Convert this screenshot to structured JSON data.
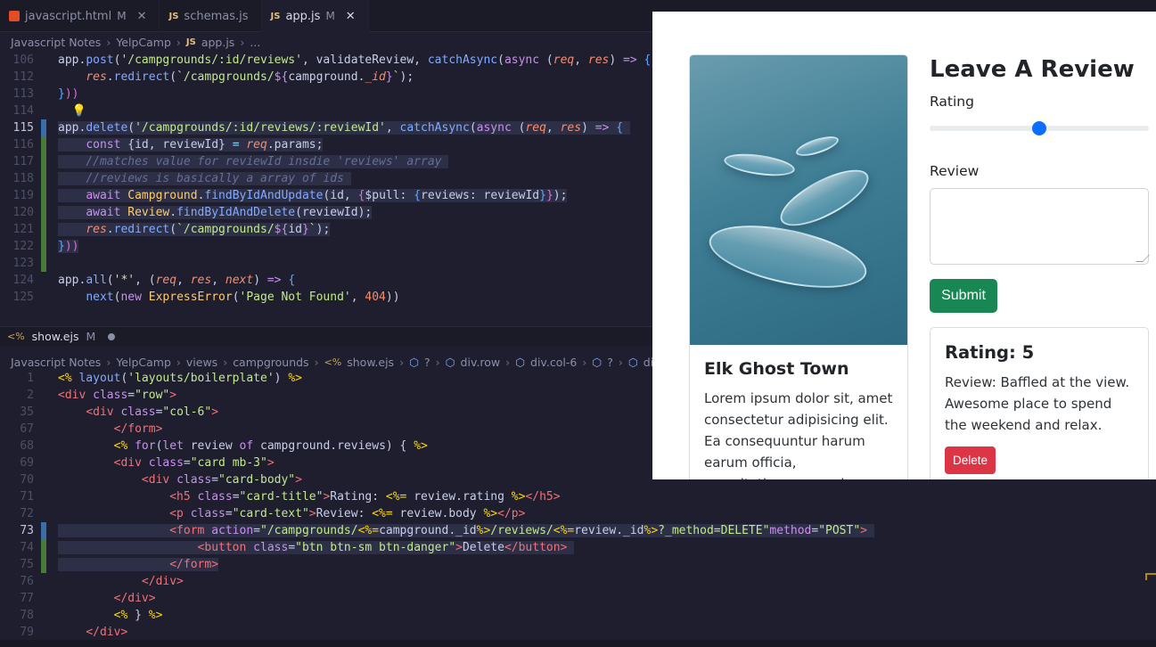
{
  "tabs": [
    {
      "name": "javascript.html",
      "badge": "M",
      "icon": "html-icon"
    },
    {
      "name": "schemas.js",
      "badge": "",
      "icon": "js-icon"
    },
    {
      "name": "app.js",
      "badge": "M",
      "icon": "js-icon"
    }
  ],
  "top_breadcrumb": [
    "Javascript Notes",
    "YelpCamp",
    "app.js",
    "..."
  ],
  "top_code": [
    {
      "n": "106",
      "html": "<span class='txt'>app.<span class='t-fn'>post</span>(<span class='t-str'>'/campgrounds/:id/reviews'</span>, validateReview, <span class='t-fn'>catchAsync</span>(<span class='t-kw'>async</span> (<span class='t-par'>req</span>, <span class='t-par'>res</span>) <span class='t-kw'>=&gt;</span> <span class='t-br3'>{</span></span>"
    },
    {
      "n": "112",
      "html": "<span class='txt'>    <span class='t-par'>res</span>.<span class='t-fn'>redirect</span>(<span class='t-str'>`/campgrounds/</span><span class='t-kw'>${</span>campground.<span class='t-par'>_id</span><span class='t-kw'>}</span><span class='t-str'>`</span>);</span>"
    },
    {
      "n": "113",
      "html": "<span class='txt'><span class='t-br3'>}</span><span class='t-br2'>))</span></span>"
    },
    {
      "n": "114",
      "html": "<span class='txt'>  <span class='t-br'>💡</span></span>"
    },
    {
      "n": "115",
      "cur": true,
      "gut": "mod",
      "hl": true,
      "html": "<span class='txt'>app.<span class='t-fn'>delete</span>(<span class='t-str'>'/campgrounds/:id/reviews/:reviewId'</span>, <span class='t-fn'>catchAsync</span>(<span class='t-kw'>async</span> (<span class='t-par'>req</span>, <span class='t-par'>res</span>) <span class='t-kw'>=&gt;</span> <span class='t-br3'>{</span> </span>"
    },
    {
      "n": "116",
      "gut": "add",
      "hl": true,
      "html": "<span class='txt'>    <span class='t-kw'>const</span> {id, reviewId} <span class='t-op'>=</span> <span class='t-par'>req</span>.params;</span>"
    },
    {
      "n": "117",
      "gut": "add",
      "hl": true,
      "html": "<span class='txt'>    <span class='t-com'>//matches value for reviewId insdie 'reviews' array </span></span>"
    },
    {
      "n": "118",
      "gut": "add",
      "hl": true,
      "html": "<span class='txt'>    <span class='t-com'>//reviews is basically a array of ids </span></span>"
    },
    {
      "n": "119",
      "gut": "add",
      "hl": true,
      "html": "<span class='txt'>    <span class='t-kw'>await</span> <span class='t-cls'>Campground</span>.<span class='t-fn'>findByIdAndUpdate</span>(id, <span class='t-br2'>{</span>$pull: <span class='t-br3'>{</span>reviews: reviewId<span class='t-br3'>}</span><span class='t-br2'>}</span>);</span>"
    },
    {
      "n": "120",
      "gut": "add",
      "hl": true,
      "html": "<span class='txt'>    <span class='t-kw'>await</span> <span class='t-cls'>Review</span>.<span class='t-fn'>findByIdAndDelete</span>(reviewId);</span>"
    },
    {
      "n": "121",
      "gut": "add",
      "hl": true,
      "html": "<span class='txt'>    <span class='t-par'>res</span>.<span class='t-fn'>redirect</span>(<span class='t-str'>`/campgrounds/</span><span class='t-kw'>${</span>id<span class='t-kw'>}</span><span class='t-str'>`</span>);</span>"
    },
    {
      "n": "122",
      "gut": "add",
      "hl": true,
      "html": "<span class='txt'><span class='t-br3'>}</span><span class='t-br2'>))</span></span>"
    },
    {
      "n": "123",
      "gut": "add",
      "html": "<span class='txt'></span>"
    },
    {
      "n": "124",
      "html": "<span class='txt'>app.<span class='t-fn'>all</span>(<span class='t-str'>'*'</span>, (<span class='t-par'>req</span>, <span class='t-par'>res</span>, <span class='t-par'>next</span>) <span class='t-kw'>=&gt;</span> <span class='t-br3'>{</span></span>"
    },
    {
      "n": "125",
      "html": "<span class='txt'>    <span class='t-fn'>next</span>(<span class='t-kw'>new</span> <span class='t-cls'>ExpressError</span>(<span class='t-str'>'Page Not Found'</span>, <span class='t-num'>404</span>))</span>"
    }
  ],
  "bottom_tab": {
    "name": "show.ejs",
    "badge": "M"
  },
  "bottom_breadcrumb": [
    "Javascript Notes",
    "YelpCamp",
    "views",
    "campgrounds",
    "show.ejs",
    "?",
    "div.row",
    "div.col-6",
    "?",
    "div.card..."
  ],
  "bottom_code": [
    {
      "n": "1",
      "html": "<span class='txt'><span class='t-ejs'>&lt;%</span> <span class='t-fn'>layout</span>(<span class='t-str'>'layouts/boilerplate'</span>) <span class='t-ejs'>%&gt;</span></span>"
    },
    {
      "n": "2",
      "html": "<span class='txt'><span class='t-tag'>&lt;div</span> <span class='t-att'>class</span>=<span class='t-str'>\"row\"</span><span class='t-tag'>&gt;</span></span>"
    },
    {
      "n": "35",
      "html": "<span class='txt'>    <span class='t-tag'>&lt;div</span> <span class='t-att'>class</span>=<span class='t-str'>\"col-6\"</span><span class='t-tag'>&gt;</span></span>"
    },
    {
      "n": "67",
      "html": "<span class='txt'>        <span class='t-tag'>&lt;/form&gt;</span></span>"
    },
    {
      "n": "68",
      "html": "<span class='txt'>        <span class='t-ejs'>&lt;%</span> <span class='t-kw'>for</span>(<span class='t-kw'>let</span> review <span class='t-kw'>of</span> campground.reviews) { <span class='t-ejs'>%&gt;</span></span>"
    },
    {
      "n": "69",
      "html": "<span class='txt'>        <span class='t-tag'>&lt;div</span> <span class='t-att'>class</span>=<span class='t-str'>\"card mb-3\"</span><span class='t-tag'>&gt;</span></span>"
    },
    {
      "n": "70",
      "html": "<span class='txt'>            <span class='t-tag'>&lt;div</span> <span class='t-att'>class</span>=<span class='t-str'>\"card-body\"</span><span class='t-tag'>&gt;</span></span>"
    },
    {
      "n": "71",
      "html": "<span class='txt'>                <span class='t-tag'>&lt;h5</span> <span class='t-att'>class</span>=<span class='t-str'>\"card-title\"</span><span class='t-tag'>&gt;</span>Rating: <span class='t-ejs'>&lt;%=</span> review.rating <span class='t-ejs'>%&gt;</span><span class='t-tag'>&lt;/h5&gt;</span></span>"
    },
    {
      "n": "72",
      "html": "<span class='txt'>                <span class='t-tag'>&lt;p</span> <span class='t-att'>class</span>=<span class='t-str'>\"card-text\"</span><span class='t-tag'>&gt;</span>Review: <span class='t-ejs'>&lt;%=</span> review.body <span class='t-ejs'>%&gt;</span><span class='t-tag'>&lt;/p&gt;</span></span>"
    },
    {
      "n": "73",
      "cur": true,
      "gut": "mod",
      "hl": true,
      "html": "<span class='txt'>                <span class='t-tag'>&lt;form</span> <span class='t-att'>action</span>=<span class='t-str'>\"/campgrounds/</span><span class='t-ejs'>&lt;%=</span>campground._id<span class='t-ejs'>%&gt;</span><span class='t-str'>/reviews/</span><span class='t-ejs'>&lt;%=</span>review._id<span class='t-ejs'>%&gt;</span><span class='t-str'>?_method=DELETE\"</span><span class='t-att'>method</span>=<span class='t-str'>\"POST\"</span><span class='t-tag'>&gt;</span> </span>"
    },
    {
      "n": "74",
      "gut": "add",
      "hl": true,
      "html": "<span class='txt'>                    <span class='t-tag'>&lt;button</span> <span class='t-att'>class</span>=<span class='t-str'>\"btn btn-sm btn-danger\"</span><span class='t-tag'>&gt;</span>Delete<span class='t-tag'>&lt;/button&gt;</span> </span>"
    },
    {
      "n": "75",
      "gut": "add",
      "hl": true,
      "html": "<span class='txt'>                <span class='t-tag'>&lt;/form&gt;</span></span>"
    },
    {
      "n": "76",
      "html": "<span class='txt'>            <span class='t-tag'>&lt;/div&gt;</span></span>"
    },
    {
      "n": "77",
      "html": "<span class='txt'>        <span class='t-tag'>&lt;/div&gt;</span></span>"
    },
    {
      "n": "78",
      "html": "<span class='txt'>        <span class='t-ejs'>&lt;%</span> } <span class='t-ejs'>%&gt;</span></span>"
    },
    {
      "n": "79",
      "html": "<span class='txt'>    <span class='t-tag'>&lt;/div&gt;</span></span>"
    }
  ],
  "preview": {
    "campground_title": "Elk Ghost Town",
    "campground_text": "Lorem ipsum dolor sit, amet consectetur adipisicing elit. Ea consequuntur harum earum officia, exercitationem quasi,",
    "review_heading": "Leave A Review",
    "rating_label": "Rating",
    "rating_value_fraction": 0.5,
    "review_label": "Review",
    "submit_label": "Submit",
    "review_card_title": "Rating: 5",
    "review_card_text": "Review: Baffled at the view. Awesome place to spend the weekend and relax.",
    "delete_label": "Delete",
    "colors": {
      "submit": "#198754",
      "delete": "#dc3545",
      "range_thumb": "#0d6efd"
    }
  }
}
